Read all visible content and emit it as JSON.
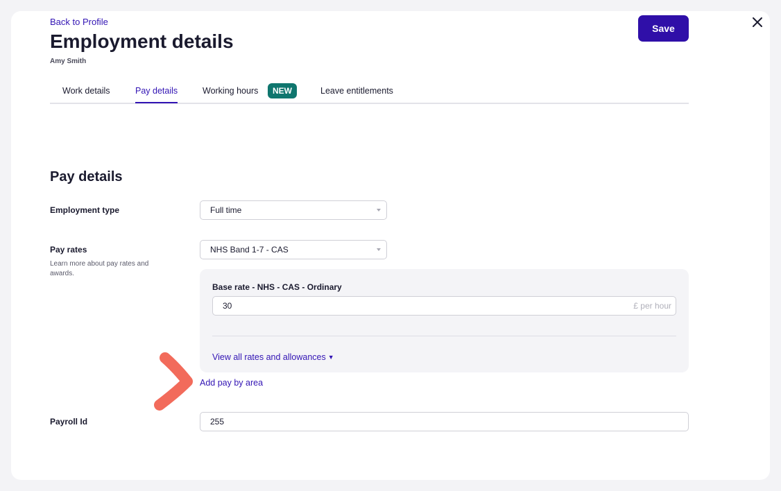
{
  "header": {
    "back_link": "Back to Profile",
    "title": "Employment details",
    "employee_name": "Amy Smith",
    "save_label": "Save"
  },
  "tabs": [
    {
      "label": "Work details",
      "active": false
    },
    {
      "label": "Pay details",
      "active": true
    },
    {
      "label": "Working hours",
      "active": false,
      "badge": "NEW"
    },
    {
      "label": "Leave entitlements",
      "active": false
    }
  ],
  "pay": {
    "section_title": "Pay details",
    "employment_type": {
      "label": "Employment type",
      "value": "Full time"
    },
    "pay_rates": {
      "label": "Pay rates",
      "helper": "Learn more about pay rates and awards.",
      "value": "NHS Band 1-7 - CAS"
    },
    "base_rate": {
      "title": "Base rate - NHS - CAS - Ordinary",
      "value": "30",
      "suffix": "£ per hour"
    },
    "view_all_link": "View all rates and allowances",
    "add_pay_link": "Add pay by area",
    "payroll": {
      "label": "Payroll Id",
      "value": "255"
    }
  },
  "colors": {
    "brand": "#2f0fa8",
    "link": "#3214b4",
    "badge": "#0f766e",
    "annotation": "#f26b5b"
  },
  "icons": {
    "close": "close-icon",
    "chevron": "chevron-down-icon",
    "dropdown_caret": "caret-down-icon"
  }
}
